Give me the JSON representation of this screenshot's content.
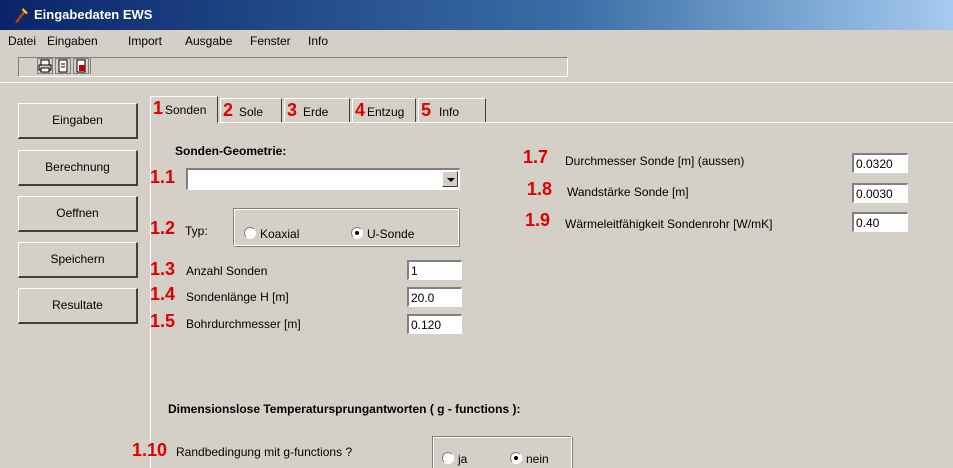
{
  "window": {
    "title": "Eingabedaten EWS"
  },
  "menu": [
    "Datei",
    "Eingaben",
    "Import",
    "Ausgabe",
    "Fenster",
    "Info"
  ],
  "toolbar": {
    "icons": [
      "print-icon",
      "page-icon",
      "print-preview-icon"
    ]
  },
  "sidebar": {
    "buttons": [
      "Eingaben",
      "Berechnung",
      "Oeffnen",
      "Speichern",
      "Resultate"
    ]
  },
  "tabs": [
    {
      "num": "1",
      "label": "Sonden"
    },
    {
      "num": "2",
      "label": "Sole"
    },
    {
      "num": "3",
      "label": "Erde"
    },
    {
      "num": "4",
      "label": "Entzug"
    },
    {
      "num": "5",
      "label": "Info"
    }
  ],
  "sonden": {
    "geometry_title": "Sonden-Geometrie:",
    "n11": "1.1",
    "geometry_value": "",
    "n12": "1.2",
    "typ_label": "Typ:",
    "typ_options": [
      "Koaxial",
      "U-Sonde"
    ],
    "typ_selected": "U-Sonde",
    "n13": "1.3",
    "anzahl_label": "Anzahl Sonden",
    "anzahl_value": "1",
    "n14": "1.4",
    "laenge_label": "Sondenlänge H [m]",
    "laenge_value": "20.0",
    "n15": "1.5",
    "bohr_label": "Bohrdurchmesser [m]",
    "bohr_value": "0.120",
    "n17": "1.7",
    "durchmesser_label": "Durchmesser Sonde [m] (aussen)",
    "durchmesser_value": "0.0320",
    "n18": "1.8",
    "wand_label": "Wandstärke Sonde [m]",
    "wand_value": "0.0030",
    "n19": "1.9",
    "waerme_label": "Wärmeleitfähigkeit Sondenrohr [W/mK]",
    "waerme_value": "0.40",
    "gfunc_title": "Dimensionslose Temperatursprungantworten  ( g - functions ):",
    "n110": "1.10",
    "rand_label": "Randbedingung mit g-functions ?",
    "rand_options": [
      "ja",
      "nein"
    ],
    "rand_selected": "nein"
  }
}
